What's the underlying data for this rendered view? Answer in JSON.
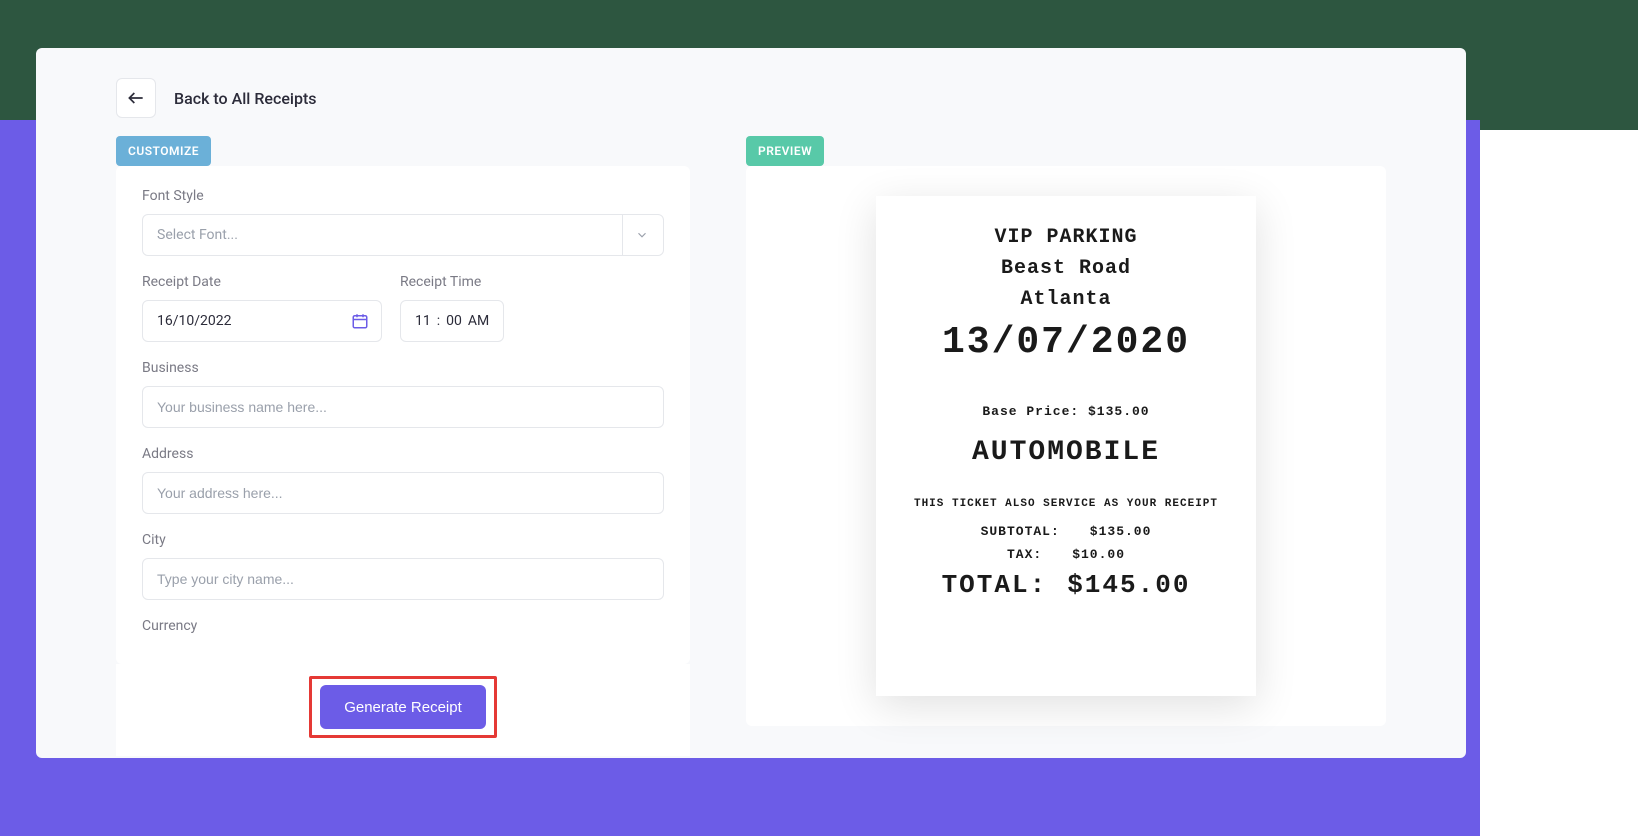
{
  "header": {
    "back_label": "Back to All Receipts"
  },
  "tags": {
    "customize": "CUSTOMIZE",
    "preview": "PREVIEW"
  },
  "form": {
    "font_style_label": "Font Style",
    "font_style_placeholder": "Select Font...",
    "receipt_date_label": "Receipt Date",
    "receipt_date_value": "16/10/2022",
    "receipt_time_label": "Receipt Time",
    "receipt_time_hour": "11",
    "receipt_time_sep": ":",
    "receipt_time_minute": "00",
    "receipt_time_ampm": "AM",
    "business_label": "Business",
    "business_placeholder": "Your business name here...",
    "address_label": "Address",
    "address_placeholder": "Your address here...",
    "city_label": "City",
    "city_placeholder": "Type your city name...",
    "currency_label": "Currency"
  },
  "actions": {
    "generate_label": "Generate Receipt"
  },
  "receipt": {
    "title": "VIP PARKING",
    "street": "Beast Road",
    "city": "Atlanta",
    "date": "13/07/2020",
    "base_price_label": "Base Price: $135.00",
    "vehicle": "AUTOMOBILE",
    "note": "THIS TICKET ALSO SERVICE AS YOUR RECEIPT",
    "subtotal_label": "SUBTOTAL:",
    "subtotal_value": "$135.00",
    "tax_label": "TAX:",
    "tax_value": "$10.00",
    "total_label": "TOTAL:",
    "total_value": "$145.00"
  }
}
